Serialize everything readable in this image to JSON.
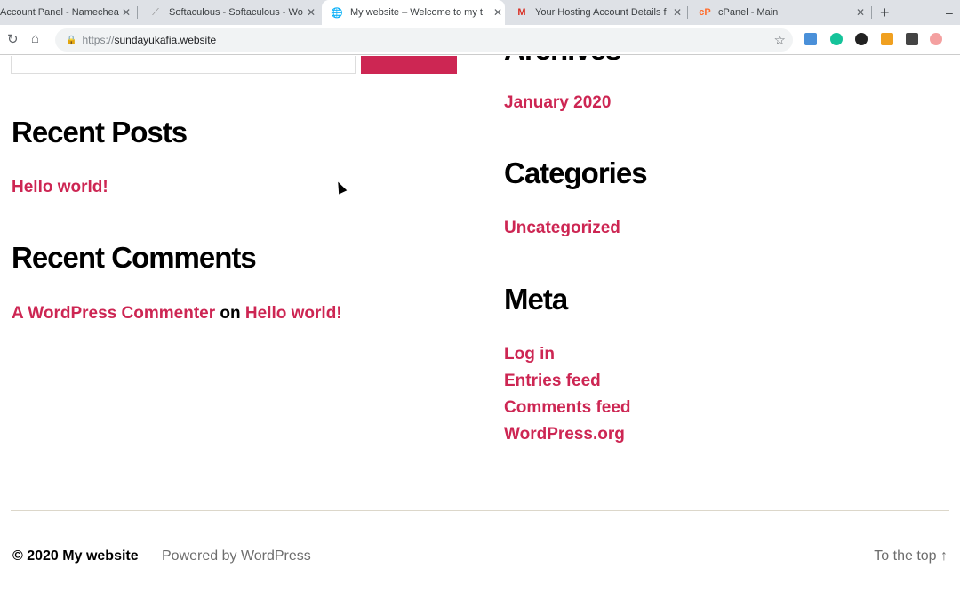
{
  "browser": {
    "tabs": [
      {
        "title": "Account Panel - Namecheap",
        "icon": "namecheap-icon"
      },
      {
        "title": "Softaculous - Softaculous - Wo",
        "icon": "softaculous-icon"
      },
      {
        "title": "My website – Welcome to my t",
        "icon": "globe-icon",
        "active": true
      },
      {
        "title": "Your Hosting Account Details f",
        "icon": "gmail-icon"
      },
      {
        "title": "cPanel - Main",
        "icon": "cpanel-icon"
      }
    ],
    "url_scheme": "https://",
    "url_host": "sundayukafia.website",
    "new_tab": "+",
    "minimize": "–"
  },
  "sidebar_left": {
    "recent_posts_title": "Recent Posts",
    "recent_posts": [
      "Hello world!"
    ],
    "recent_comments_title": "Recent Comments",
    "comment": {
      "author": "A WordPress Commenter",
      "on": "on",
      "post": "Hello world!"
    }
  },
  "sidebar_right": {
    "archives_title": "Archives",
    "archives": [
      "January 2020"
    ],
    "categories_title": "Categories",
    "categories": [
      "Uncategorized"
    ],
    "meta_title": "Meta",
    "meta": [
      "Log in",
      "Entries feed",
      "Comments feed",
      "WordPress.org"
    ]
  },
  "footer": {
    "copyright": "© 2020 My website",
    "powered": "Powered by WordPress",
    "top": "To the top ↑"
  },
  "colors": {
    "accent": "#cd2653"
  }
}
